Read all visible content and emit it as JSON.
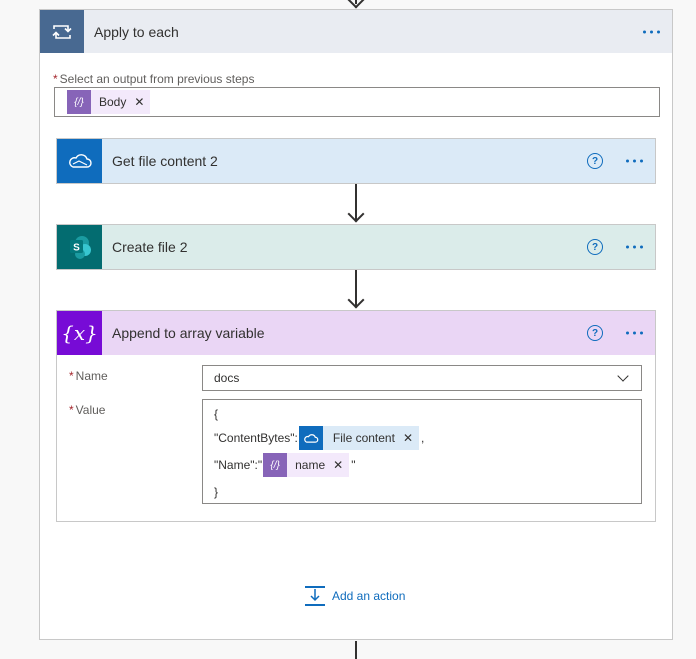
{
  "scope": {
    "title": "Apply to each",
    "output_label": "Select an output from previous steps",
    "output_token": "Body"
  },
  "actions": {
    "get_file": {
      "title": "Get file content 2",
      "color": "#dbeaf7"
    },
    "create_file": {
      "title": "Create file 2",
      "color": "#dbecea"
    },
    "append": {
      "title": "Append to array variable",
      "name_label": "Name",
      "name_value": "docs",
      "value_label": "Value",
      "value_lines": {
        "open_brace": "{",
        "content_key": "\"ContentBytes\":",
        "content_token": "File content",
        "content_after": ",",
        "name_key": "\"Name\":\"",
        "name_token": "name",
        "name_after": "\"",
        "close_brace": "}"
      }
    }
  },
  "add_action": {
    "label": "Add an action"
  },
  "icons": {
    "scope": "loop-icon",
    "onedrive": "cloud-icon",
    "sharepoint": "sharepoint-icon",
    "variable": "variable-icon",
    "token": "expression-icon"
  },
  "colors": {
    "accent": "#0f6cbd",
    "scope_icon_bg": "#486991",
    "onedrive_bg": "#0f6cbd",
    "sharepoint_bg": "#036c70",
    "variable_bg": "#770bd6"
  }
}
